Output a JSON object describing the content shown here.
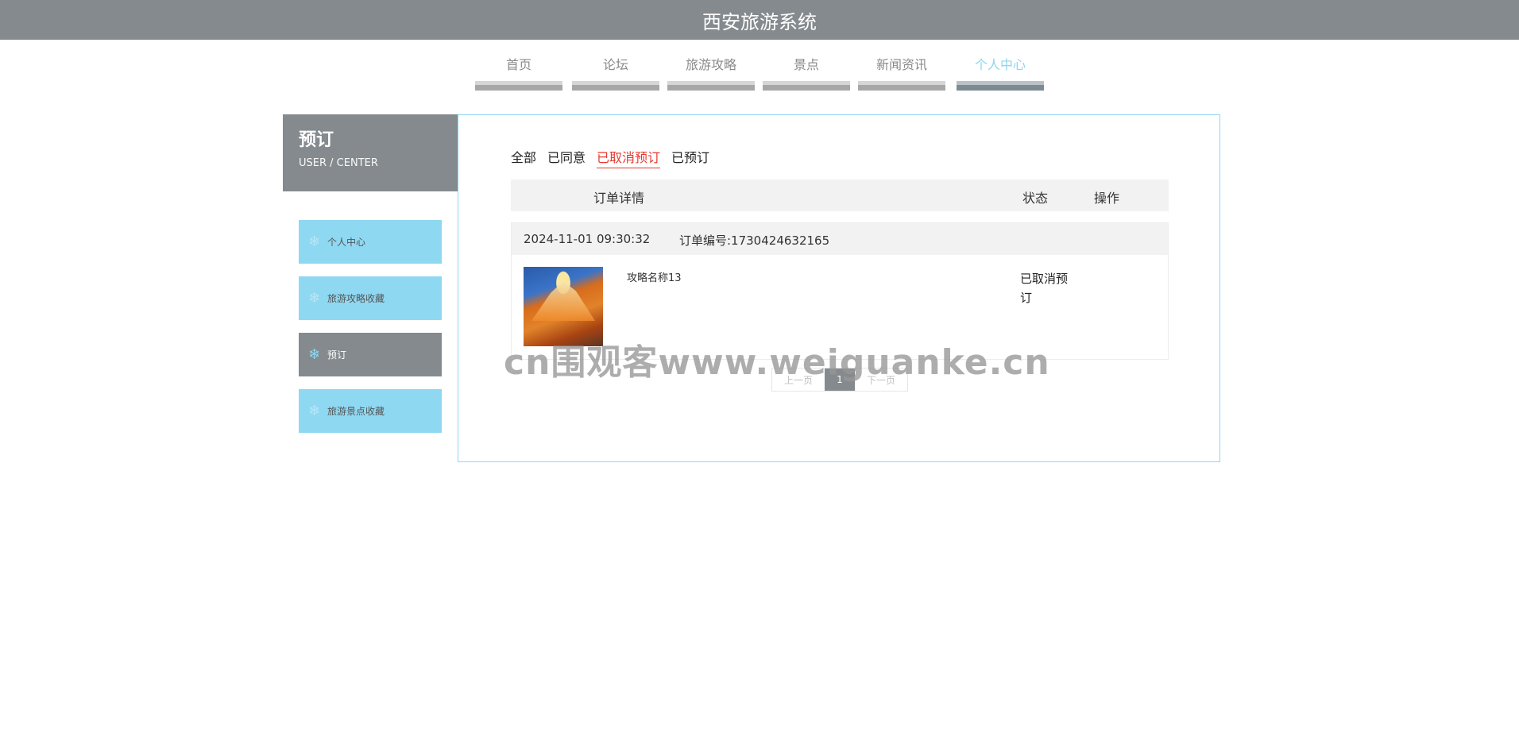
{
  "header": {
    "title": "西安旅游系统"
  },
  "nav": {
    "items": [
      {
        "label": "首页"
      },
      {
        "label": "论坛"
      },
      {
        "label": "旅游攻略"
      },
      {
        "label": "景点"
      },
      {
        "label": "新闻资讯"
      },
      {
        "label": "个人中心",
        "active": true
      }
    ]
  },
  "sidebar": {
    "title": "预订",
    "subtitle": "USER / CENTER",
    "items": [
      {
        "label": "个人中心",
        "icon": "snowflake-icon"
      },
      {
        "label": "旅游攻略收藏",
        "icon": "snowflake-icon"
      },
      {
        "label": "预订",
        "icon": "snowflake-icon",
        "active": true
      },
      {
        "label": "旅游景点收藏",
        "icon": "snowflake-icon"
      }
    ]
  },
  "filters": {
    "items": [
      {
        "label": "全部"
      },
      {
        "label": "已同意"
      },
      {
        "label": "已取消预订",
        "active": true
      },
      {
        "label": "已预订"
      }
    ]
  },
  "table": {
    "columns": [
      "订单详情",
      "状态",
      "操作"
    ]
  },
  "order": {
    "time": "2024-11-01 09:30:32",
    "number": "订单编号:1730424632165",
    "name": "攻略名称13",
    "status": "已取消预订"
  },
  "pager": {
    "prev": "上一页",
    "page": "1",
    "next": "下一页"
  },
  "watermark": "cn围观客www.weiguanke.cn",
  "colors": {
    "header_bg": "#848a8d",
    "accent": "#8fd8f2",
    "active_red": "#e8372f"
  }
}
